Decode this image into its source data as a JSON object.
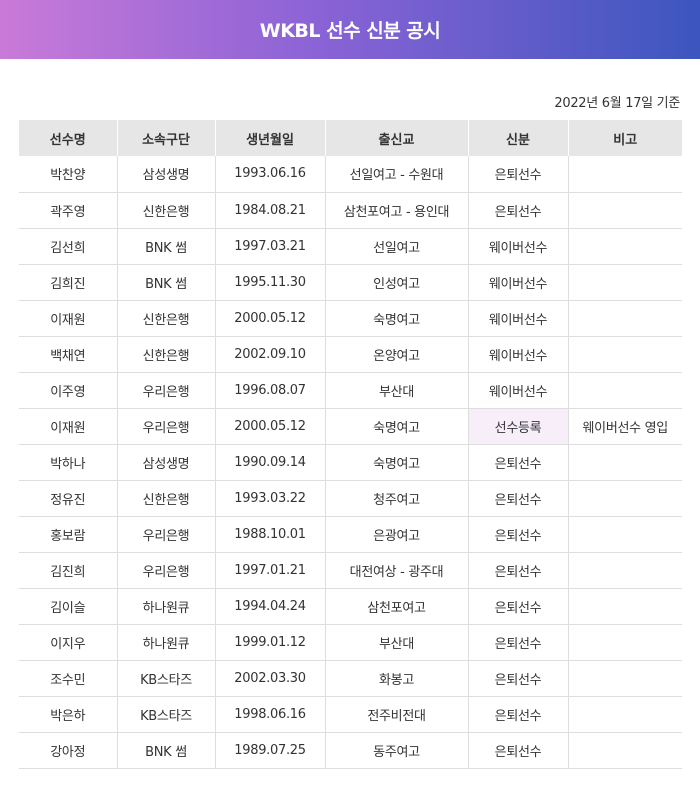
{
  "header": {
    "title": "WKBL 선수 신분 공시"
  },
  "date_line": "2022년 6월 17일 기준",
  "table": {
    "columns": [
      "선수명",
      "소속구단",
      "생년월일",
      "출신교",
      "신분",
      "비고"
    ],
    "rows": [
      [
        "박찬양",
        "삼성생명",
        "1993.06.16",
        "선일여고 - 수원대",
        "은퇴선수",
        ""
      ],
      [
        "곽주영",
        "신한은행",
        "1984.08.21",
        "삼천포여고 - 용인대",
        "은퇴선수",
        ""
      ],
      [
        "김선희",
        "BNK 썸",
        "1997.03.21",
        "선일여고",
        "웨이버선수",
        ""
      ],
      [
        "김희진",
        "BNK 썸",
        "1995.11.30",
        "인성여고",
        "웨이버선수",
        ""
      ],
      [
        "이재원",
        "신한은행",
        "2000.05.12",
        "숙명여고",
        "웨이버선수",
        ""
      ],
      [
        "백채연",
        "신한은행",
        "2002.09.10",
        "온양여고",
        "웨이버선수",
        ""
      ],
      [
        "이주영",
        "우리은행",
        "1996.08.07",
        "부산대",
        "웨이버선수",
        ""
      ],
      [
        "이재원",
        "우리은행",
        "2000.05.12",
        "숙명여고",
        "선수등록",
        "웨이버선수 영입"
      ],
      [
        "박하나",
        "삼성생명",
        "1990.09.14",
        "숙명여고",
        "은퇴선수",
        ""
      ],
      [
        "정유진",
        "신한은행",
        "1993.03.22",
        "청주여고",
        "은퇴선수",
        ""
      ],
      [
        "홍보람",
        "우리은행",
        "1988.10.01",
        "은광여고",
        "은퇴선수",
        ""
      ],
      [
        "김진희",
        "우리은행",
        "1997.01.21",
        "대전여상 - 광주대",
        "은퇴선수",
        ""
      ],
      [
        "김이슬",
        "하나원큐",
        "1994.04.24",
        "삼천포여고",
        "은퇴선수",
        ""
      ],
      [
        "이지우",
        "하나원큐",
        "1999.01.12",
        "부산대",
        "은퇴선수",
        ""
      ],
      [
        "조수민",
        "KB스타즈",
        "2002.03.30",
        "화봉고",
        "은퇴선수",
        ""
      ],
      [
        "박은하",
        "KB스타즈",
        "1998.06.16",
        "전주비전대",
        "은퇴선수",
        ""
      ],
      [
        "강아정",
        "BNK 썸",
        "1989.07.25",
        "동주여고",
        "은퇴선수",
        ""
      ]
    ],
    "highlight": {
      "row": 7,
      "col": 4,
      "color": "#f7eefa"
    }
  }
}
